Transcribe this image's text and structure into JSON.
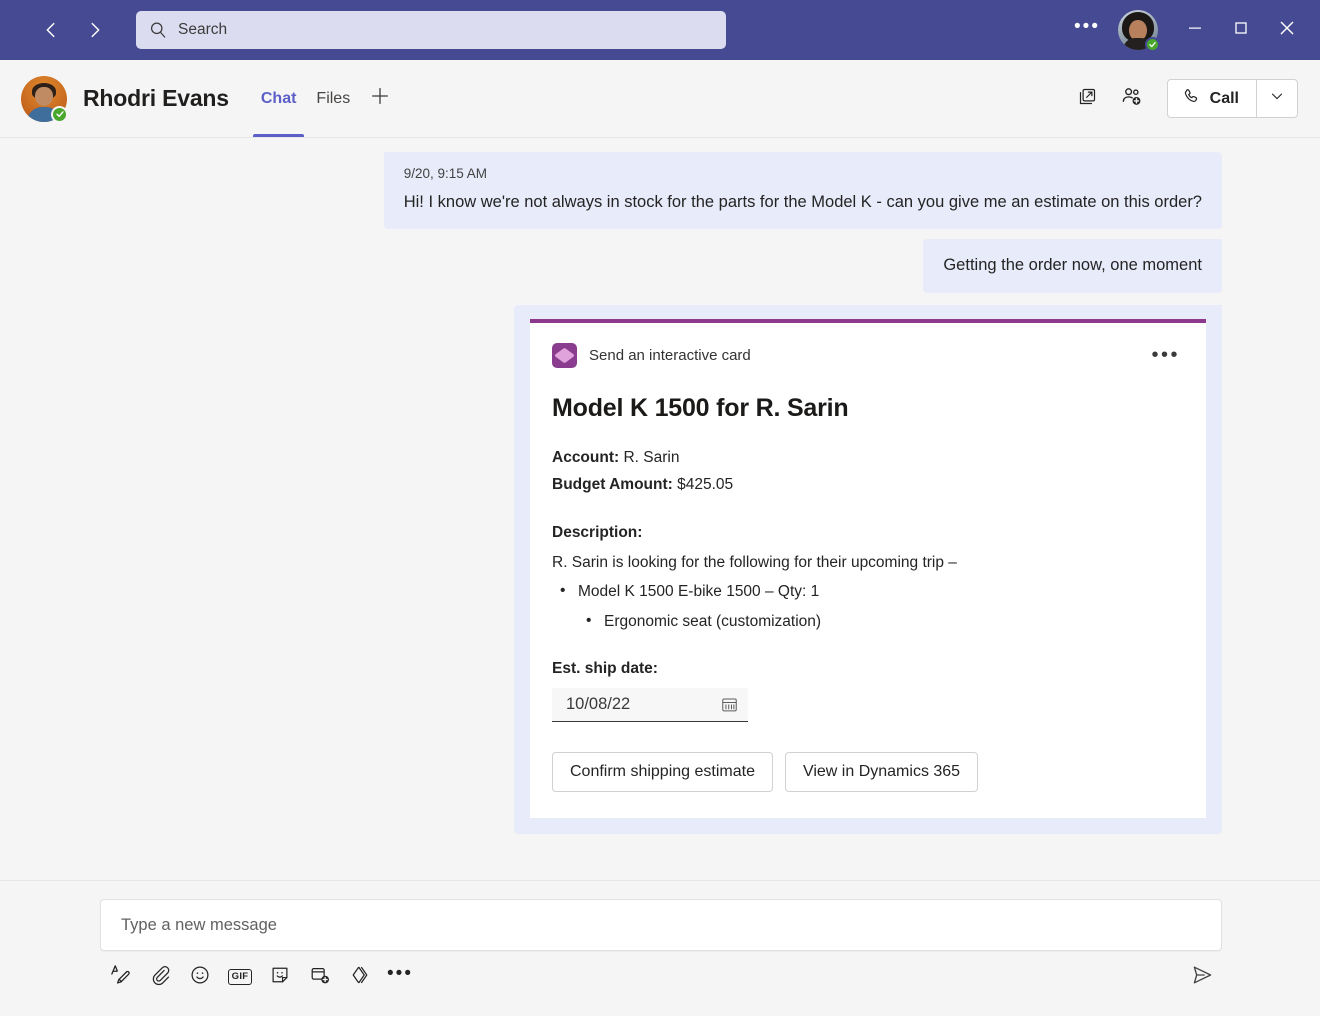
{
  "titlebar": {
    "back_icon": "chevron-left-icon",
    "forward_icon": "chevron-right-icon",
    "search_placeholder": "Search",
    "more_label": "•••",
    "minimize_label": "minimize",
    "maximize_label": "maximize",
    "close_label": "close",
    "bg_color": "#464a92",
    "search_bg": "#dcdcf0"
  },
  "chat_header": {
    "peer_name": "Rhodri Evans",
    "tabs": [
      {
        "label": "Chat",
        "active": true
      },
      {
        "label": "Files",
        "active": false
      }
    ],
    "add_tab_label": "+",
    "pop_out_icon": "pop-out-icon",
    "add_people_icon": "add-people-icon",
    "call_label": "Call",
    "accent_color": "#5b5fc7"
  },
  "conversation": {
    "messages": [
      {
        "time": "9/20, 9:15 AM",
        "text": "Hi! I know we're not always in stock for the parts for the Model K - can you give me an estimate on this order?",
        "side": "in"
      },
      {
        "time": "",
        "text": "Getting the order now, one moment",
        "side": "out"
      }
    ],
    "card": {
      "source_label": "Send an interactive card",
      "more_label": "•••",
      "title": "Model K 1500 for R. Sarin",
      "fields": [
        {
          "label": "Account:",
          "value": "R. Sarin"
        },
        {
          "label": "Budget Amount:",
          "value": "$425.05"
        }
      ],
      "description_label": "Description:",
      "description_text": "R. Sarin is looking for the following for their upcoming trip –",
      "bullets": [
        {
          "text": "Model K 1500 E-bike 1500 – Qty: 1"
        }
      ],
      "sub_bullets": [
        {
          "text": "Ergonomic seat (customization)"
        }
      ],
      "ship_date_label": "Est. ship date:",
      "ship_date_value": "10/08/22",
      "calendar_icon": "calendar-icon",
      "buttons": [
        {
          "label": "Confirm shipping estimate"
        },
        {
          "label": "View in Dynamics 365"
        }
      ],
      "accent_color": "#8d3a8e",
      "bubble_color": "#e8ebfa"
    }
  },
  "compose": {
    "placeholder": "Type a new message",
    "tools": [
      {
        "name": "format-icon"
      },
      {
        "name": "attach-icon"
      },
      {
        "name": "emoji-icon"
      },
      {
        "name": "gif-icon",
        "label": "GIF"
      },
      {
        "name": "sticker-icon"
      },
      {
        "name": "meet-now-icon"
      },
      {
        "name": "power-automate-icon"
      },
      {
        "name": "more-options-icon",
        "label": "•••"
      }
    ],
    "send_icon": "send-icon"
  }
}
